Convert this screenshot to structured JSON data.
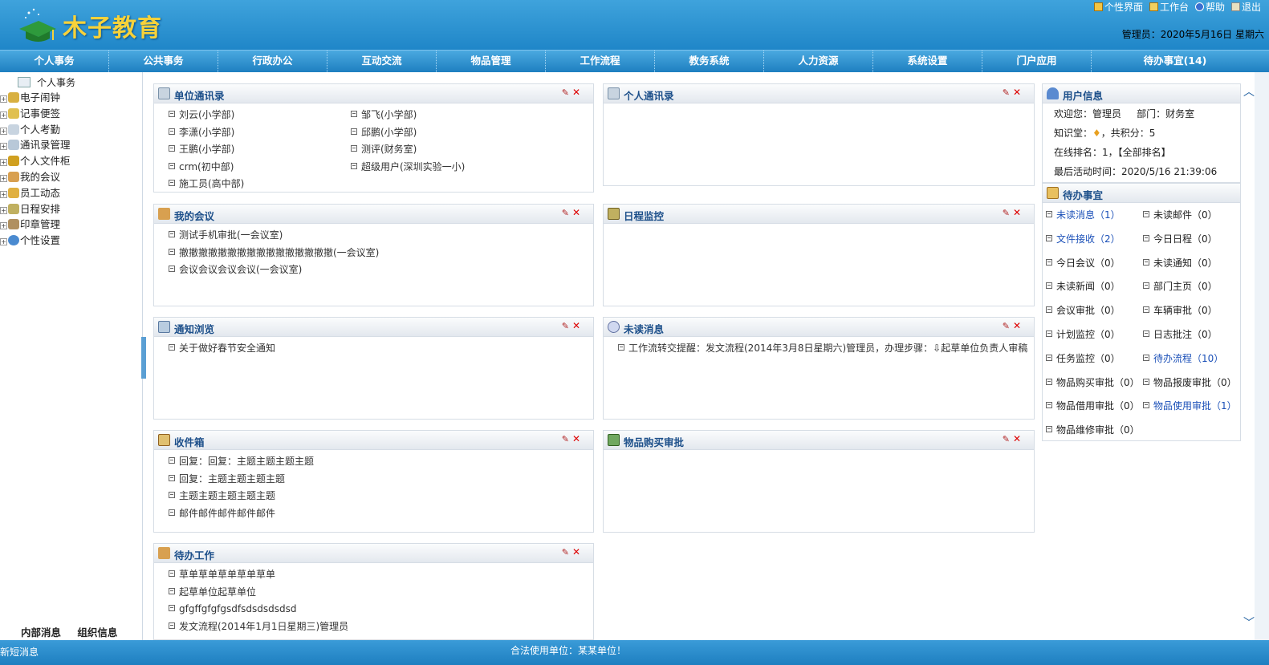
{
  "app": {
    "logo_text": "木子教育"
  },
  "toplinks": [
    {
      "label": "个性界面",
      "icon": "personalize-icon"
    },
    {
      "label": "工作台",
      "icon": "workbench-icon"
    },
    {
      "label": "帮助",
      "icon": "help-icon"
    },
    {
      "label": "退出",
      "icon": "logout-icon"
    }
  ],
  "userline": "管理员：2020年5月16日  星期六",
  "nav": [
    "个人事务",
    "公共事务",
    "行政办公",
    "互动交流",
    "物品管理",
    "工作流程",
    "教务系统",
    "人力资源",
    "系统设置",
    "门户应用",
    "待办事宜(14)"
  ],
  "tree": {
    "root": "个人事务",
    "items": [
      "电子闹钟",
      "记事便签",
      "个人考勤",
      "通讯录管理",
      "个人文件柜",
      "我的会议",
      "员工动态",
      "日程安排",
      "印章管理",
      "个性设置"
    ]
  },
  "left_bottom": {
    "msg": "内部消息",
    "org": "组织信息"
  },
  "panels": {
    "unit_contacts": {
      "title": "单位通讯录",
      "col1": [
        "刘云(小学部)",
        "李潇(小学部)",
        "王鹏(小学部)",
        "crm(初中部)",
        "施工员(高中部)"
      ],
      "col2": [
        "邹飞(小学部)",
        "邱鹏(小学部)",
        "测评(财务室)",
        "超级用户(深圳实验一小)"
      ]
    },
    "personal_contacts": {
      "title": "个人通讯录"
    },
    "my_meetings": {
      "title": "我的会议",
      "items": [
        "测试手机审批(一会议室)",
        "撤撤撤撤撤撤撤撤撤撤撤撤撤撤撤撤(一会议室)",
        "会议会议会议会议(一会议室)"
      ]
    },
    "schedule_monitor": {
      "title": "日程监控"
    },
    "notice": {
      "title": "通知浏览",
      "items": [
        "关于做好春节安全通知"
      ]
    },
    "unread_msg": {
      "title": "未读消息",
      "items": [
        "工作流转交提醒：发文流程(2014年3月8日星期六)管理员，办理步骤：⇩起草单位负责人审稿"
      ]
    },
    "inbox": {
      "title": "收件箱",
      "items": [
        "回复：回复：主题主题主题主题",
        "回复：主题主题主题主题",
        "主题主题主题主题主题",
        "邮件邮件邮件邮件邮件"
      ]
    },
    "purchase_approval": {
      "title": "物品购买审批"
    },
    "todo_work": {
      "title": "待办工作",
      "items": [
        "草单草单草单草单草单",
        "起草单位起草单位",
        "gfgffgfgfgsdfsdsdsdsdsd",
        "发文流程(2014年1月1日星期三)管理员"
      ]
    }
  },
  "user_info": {
    "title": "用户信息",
    "welcome": "欢迎您：管理员",
    "dept": "部门：财务室",
    "knowledge": "知识堂：",
    "points": "，共积分：5",
    "rank": "在线排名：1，【全部排名】",
    "last_active": "最后活动时间：2020/5/16 21:39:06"
  },
  "todo_list": {
    "title": "待办事宜",
    "items": [
      {
        "label": "未读消息（1）",
        "highlight": true
      },
      {
        "label": "未读邮件（0）",
        "highlight": false
      },
      {
        "label": "文件接收（2）",
        "highlight": true
      },
      {
        "label": "今日日程（0）",
        "highlight": false
      },
      {
        "label": "今日会议（0）",
        "highlight": false
      },
      {
        "label": "未读通知（0）",
        "highlight": false
      },
      {
        "label": "未读新闻（0）",
        "highlight": false
      },
      {
        "label": "部门主页（0）",
        "highlight": false
      },
      {
        "label": "会议审批（0）",
        "highlight": false
      },
      {
        "label": "车辆审批（0）",
        "highlight": false
      },
      {
        "label": "计划监控（0）",
        "highlight": false
      },
      {
        "label": "日志批注（0）",
        "highlight": false
      },
      {
        "label": "任务监控（0）",
        "highlight": false
      },
      {
        "label": "待办流程（10）",
        "highlight": true
      },
      {
        "label": "物品购买审批（0）",
        "highlight": false
      },
      {
        "label": "物品报废审批（0）",
        "highlight": false
      },
      {
        "label": "物品借用审批（0）",
        "highlight": false
      },
      {
        "label": "物品使用审批（1）",
        "highlight": true
      },
      {
        "label": "物品维修审批（0）",
        "highlight": false
      }
    ]
  },
  "status": {
    "sms": "新短消息",
    "license": "合法使用单位：某某单位！"
  },
  "colors": {
    "header": "#2b92d2",
    "accent": "#1c4f8a",
    "logo": "#f7d23a"
  }
}
